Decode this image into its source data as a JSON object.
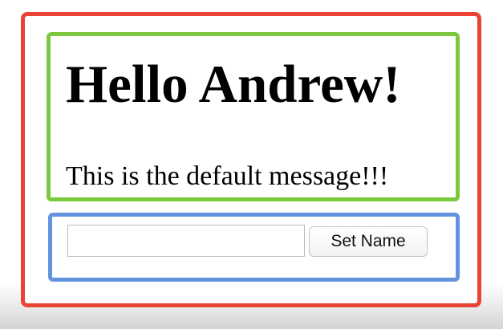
{
  "greeting": {
    "title": "Hello Andrew!",
    "message": "This is the default message!!!"
  },
  "form": {
    "name_input_value": "",
    "set_name_label": "Set Name"
  },
  "colors": {
    "app_border": "#ea4335",
    "greeting_border": "#7cc83c",
    "form_border": "#6393e0"
  }
}
